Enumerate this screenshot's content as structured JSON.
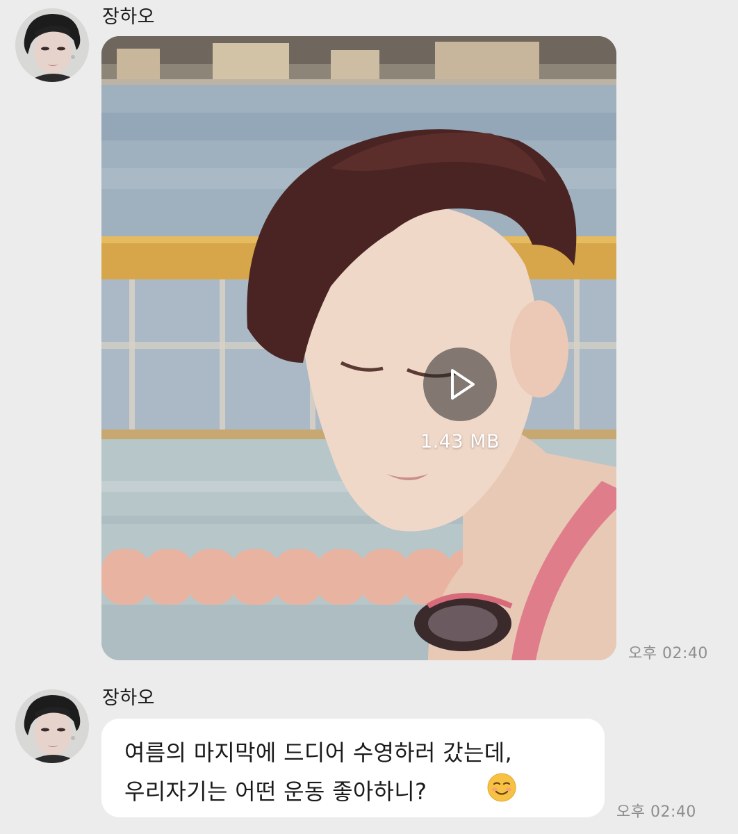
{
  "messages": [
    {
      "sender": "장하오",
      "type": "video",
      "file_size": "1.43 MB",
      "time": "오후 02:40",
      "play_icon": "play-icon"
    },
    {
      "sender": "장하오",
      "type": "text",
      "lines": [
        "여름의 마지막에 드디어 수영하러 갔는데,",
        "우리자기는 어떤 운동 좋아하니?"
      ],
      "emoji": "smiling-face-emoji",
      "time": "오후 02:40"
    }
  ],
  "colors": {
    "background": "#ececec",
    "bubble": "#ffffff",
    "timestamp": "#8e8e8e",
    "text": "#1a1a1a"
  }
}
